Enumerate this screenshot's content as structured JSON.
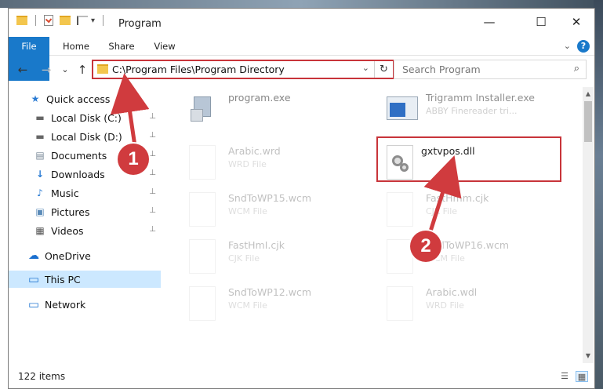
{
  "window": {
    "title": "Program",
    "minimize_glyph": "—",
    "maximize_glyph": "☐",
    "close_glyph": "✕"
  },
  "ribbon": {
    "tabs": [
      "File",
      "Home",
      "Share",
      "View"
    ],
    "help_glyph": "?",
    "collapse_glyph": "⌄"
  },
  "nav": {
    "back_glyph": "←",
    "forward_glyph": "→",
    "recent_glyph": "⌄",
    "up_glyph": "↑",
    "address": "C:\\Program Files\\Program Directory",
    "address_dropdown_glyph": "⌄",
    "refresh_glyph": "↻",
    "search_placeholder": "Search Program",
    "search_glyph": "⌕"
  },
  "sidebar": {
    "items": [
      {
        "label": "Quick access",
        "icon": "star-icon",
        "glyph": "★",
        "color": "#2a7bd3"
      },
      {
        "label": "Local Disk (C:)",
        "icon": "drive-icon",
        "glyph": "▬",
        "color": "#666666",
        "pinned": true
      },
      {
        "label": "Local Disk (D:)",
        "icon": "drive-icon",
        "glyph": "▬",
        "color": "#666666",
        "pinned": true
      },
      {
        "label": "Documents",
        "icon": "documents-icon",
        "glyph": "▤",
        "color": "#7a8a99",
        "pinned": true
      },
      {
        "label": "Downloads",
        "icon": "downloads-icon",
        "glyph": "↓",
        "color": "#2a7bd3",
        "pinned": true
      },
      {
        "label": "Music",
        "icon": "music-icon",
        "glyph": "♪",
        "color": "#2a7bd3",
        "pinned": true
      },
      {
        "label": "Pictures",
        "icon": "pictures-icon",
        "glyph": "▣",
        "color": "#5b8bb8",
        "pinned": true
      },
      {
        "label": "Videos",
        "icon": "videos-icon",
        "glyph": "▦",
        "color": "#555555",
        "pinned": true
      },
      {
        "label": "OneDrive",
        "icon": "cloud-icon",
        "glyph": "☁",
        "color": "#1a6fcf"
      },
      {
        "label": "This PC",
        "icon": "computer-icon",
        "glyph": "▭",
        "color": "#2a7bd3",
        "selected": true
      },
      {
        "label": "Network",
        "icon": "network-icon",
        "glyph": "▭",
        "color": "#2a7bd3"
      }
    ],
    "pin_glyph": "📌"
  },
  "files": [
    {
      "name": "program.exe",
      "type": ""
    },
    {
      "name": "Trigramm Installer.exe",
      "type": "ABBY Finereader tri..."
    },
    {
      "name": "Arabic.wrd",
      "type": "WRD File"
    },
    {
      "name": "gxtvpos.dll",
      "type": ""
    },
    {
      "name": "SndToWP15.wcm",
      "type": "WCM File"
    },
    {
      "name": "FastHmm.cjk",
      "type": "CJK File"
    },
    {
      "name": "FastHmI.cjk",
      "type": "CJK File"
    },
    {
      "name": "SndToWP16.wcm",
      "type": "WCM File"
    },
    {
      "name": "SndToWP12.wcm",
      "type": "WCM File"
    },
    {
      "name": "Arabic.wdl",
      "type": "WRD File"
    }
  ],
  "status": {
    "item_count": "122 items"
  },
  "callouts": [
    "1",
    "2"
  ],
  "colors": {
    "accent": "#1979ca",
    "highlight": "#c8343a",
    "callout": "#d03b3e",
    "selected_row": "#cce8ff"
  }
}
